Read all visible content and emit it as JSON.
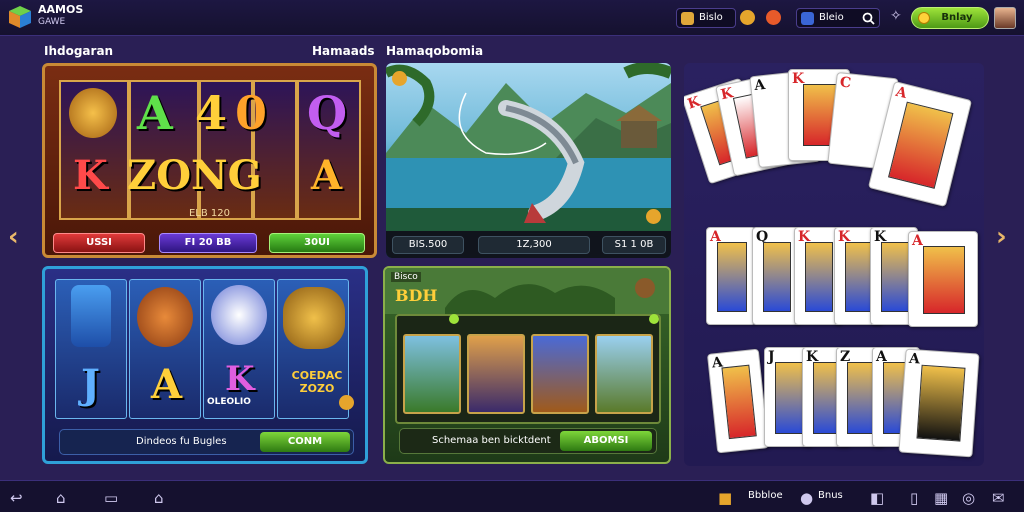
{
  "header": {
    "logo_line1": "AAMOS",
    "logo_line2": "GAWE",
    "pill1": "Bislo",
    "pill2": "Bleio",
    "cta": "Bnlay"
  },
  "sections": {
    "left_label": "Ihdogaran",
    "mid_label1": "Hamaads",
    "mid_label2": "Hamaqobomia"
  },
  "slot1": {
    "row1": [
      "A",
      "4",
      "0",
      "Q"
    ],
    "row2": [
      "K",
      "ZONG",
      "A"
    ],
    "sub": "ELB 120",
    "buttons": [
      "USSI",
      "FI 20 BB",
      "30UI"
    ]
  },
  "fishing": {
    "chips": [
      "BIS.500",
      "1Z,300",
      "S1 1 0B"
    ]
  },
  "slot2": {
    "letters": [
      "J",
      "A",
      "K"
    ],
    "reel4_text": "COEDAC ZOZO",
    "reel3_text": "OLEOLIO",
    "bar_text": "Dindeos fu Bugles",
    "bar_button": "CONM"
  },
  "jungle": {
    "title_small": "Bisco",
    "title": "BDH",
    "bar_text": "Schemaa ben bicktdent",
    "bar_button": "ABOMSI"
  },
  "cards": {
    "row1": [
      "K",
      "K",
      "A",
      "K",
      "C",
      "A"
    ],
    "row2": [
      "A",
      "Q",
      "K",
      "K",
      "K",
      "A"
    ],
    "row3": [
      "A",
      "J",
      "K",
      "Z",
      "A",
      "A"
    ]
  },
  "footer": {
    "text1": "Bbbloe",
    "text2": "Bnus"
  },
  "colors": {
    "bg": "#2a1f55",
    "accent_green": "#7ec72a",
    "card_red": "#d7262a"
  }
}
